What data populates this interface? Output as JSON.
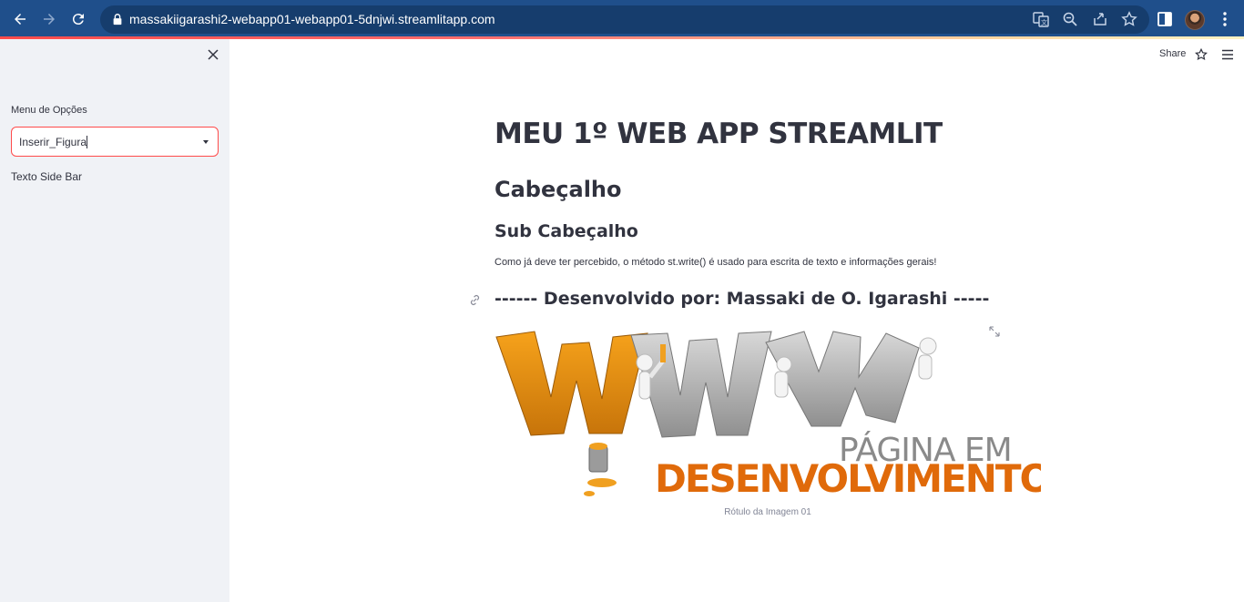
{
  "browser": {
    "url": "massakiigarashi2-webapp01-webapp01-5dnjwi.streamlitapp.com",
    "icons": [
      "back-icon",
      "forward-icon",
      "reload-icon",
      "lock-icon",
      "translate-icon",
      "zoom-icon",
      "share-page-icon",
      "bookmark-star-icon",
      "side-panel-icon",
      "avatar",
      "kebab-menu-icon"
    ]
  },
  "sidebar": {
    "label": "Menu de Opções",
    "select_value": "Inserir_Figura",
    "text": "Texto Side Bar"
  },
  "header": {
    "share_label": "Share"
  },
  "main": {
    "title": "MEU 1º WEB APP STREAMLIT",
    "header": "Cabeçalho",
    "subheader": "Sub Cabeçalho",
    "paragraph": "Como já deve ter percebido, o método st.write() é usado para escrita de texto e informações gerais!",
    "developer": "------ Desenvolvido por: Massaki de O. Igarashi -----",
    "image": {
      "line1": "PÁGINA EM",
      "line2": "DESENVOLVIMENTO",
      "caption": "Rótulo da Imagem 01"
    }
  },
  "colors": {
    "toolbar": "#1f4f8b",
    "accent": "#ff4b4b",
    "sidebar_bg": "#f0f2f6",
    "text": "#31333f",
    "figure_orange": "#e06a0a"
  }
}
